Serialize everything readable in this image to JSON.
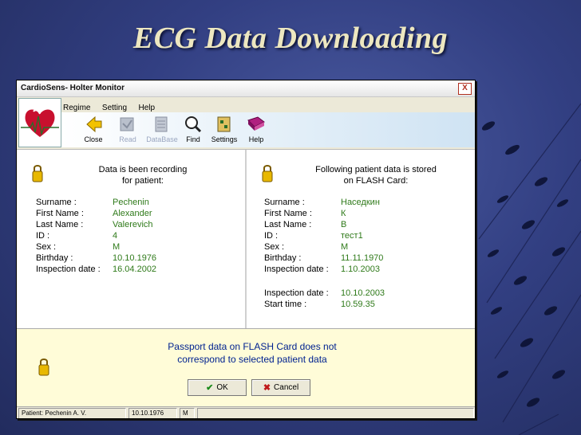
{
  "slide": {
    "title": "ECG Data Downloading"
  },
  "window": {
    "title": "CardioSens- Holter Monitor",
    "close_glyph": "X"
  },
  "menu": [
    "Regime",
    "Setting",
    "Help"
  ],
  "toolbar": [
    {
      "label": "Close",
      "icon": "close-arrow-icon",
      "enabled": true
    },
    {
      "label": "Read",
      "icon": "read-icon",
      "enabled": false
    },
    {
      "label": "DataBase",
      "icon": "database-icon",
      "enabled": false
    },
    {
      "label": "Find",
      "icon": "find-icon",
      "enabled": true
    },
    {
      "label": "Settings",
      "icon": "settings-icon",
      "enabled": true
    },
    {
      "label": "Help",
      "icon": "help-book-icon",
      "enabled": true
    }
  ],
  "left_panel": {
    "heading_line1": "Data is been recording",
    "heading_line2": "for patient:",
    "fields": [
      {
        "label": "Surname :",
        "value": "Pechenin"
      },
      {
        "label": "First Name :",
        "value": "Alexander"
      },
      {
        "label": "Last Name :",
        "value": "Valerevich"
      },
      {
        "label": "ID :",
        "value": "4"
      },
      {
        "label": "Sex :",
        "value": "M"
      },
      {
        "label": "Birthday :",
        "value": "10.10.1976"
      },
      {
        "label": "Inspection date :",
        "value": "16.04.2002"
      }
    ]
  },
  "right_panel": {
    "heading_line1": "Following patient data is stored",
    "heading_line2": "on FLASH Card:",
    "fields": [
      {
        "label": "Surname :",
        "value": "Наседкин"
      },
      {
        "label": "First Name :",
        "value": "К"
      },
      {
        "label": "Last Name :",
        "value": "В"
      },
      {
        "label": "ID :",
        "value": "тест1"
      },
      {
        "label": "Sex :",
        "value": "М"
      },
      {
        "label": "Birthday :",
        "value": "11.11.1970"
      },
      {
        "label": "Inspection date :",
        "value": "1.10.2003"
      }
    ],
    "extra_fields": [
      {
        "label": "Inspection date :",
        "value": "10.10.2003"
      },
      {
        "label": "Start time :",
        "value": "10.59.35"
      }
    ]
  },
  "notice": {
    "line1": "Passport data on FLASH Card does not",
    "line2": "correspond to selected patient data",
    "ok_label": "OK",
    "cancel_label": "Cancel"
  },
  "statusbar": {
    "patient": "Patient: Pechenin  A. V.",
    "birthday": "10.10.1976",
    "sex": "M"
  },
  "colors": {
    "value_green": "#2f7a1a",
    "notice_blue": "#002290",
    "slide_title": "#ede7c0"
  }
}
